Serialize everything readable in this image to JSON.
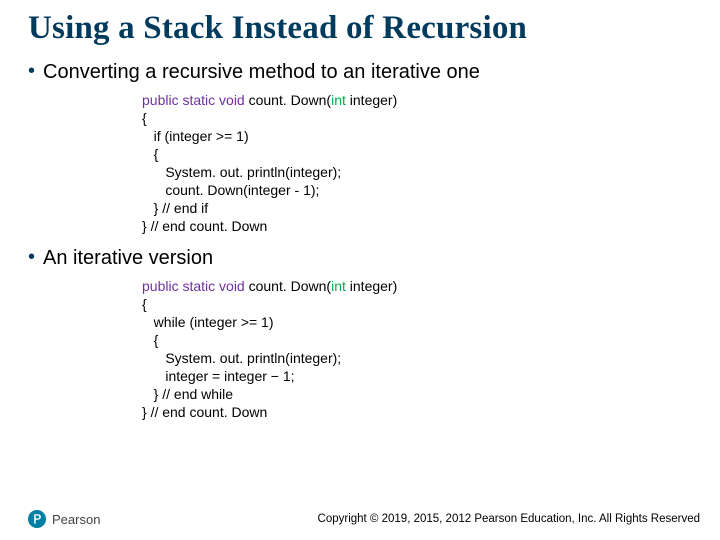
{
  "title": "Using a Stack Instead of Recursion",
  "bullet1": "Converting a recursive method to an iterative one",
  "bullet2": "An iterative version",
  "code1": {
    "sig_prefix": "public static void",
    "sig_name": " count. Down(",
    "sig_param_type": "int",
    "sig_param_name": " integer)",
    "l2": "{",
    "l3": "   if (integer >= 1)",
    "l4": "   {",
    "l5": "      System. out. println(integer);",
    "l6": "      count. Down(integer - 1);",
    "l7": "   } // end if",
    "l8": "} // end count. Down"
  },
  "code2": {
    "sig_prefix": "public static void",
    "sig_name": " count. Down(",
    "sig_param_type": "int",
    "sig_param_name": " integer)",
    "l2": "{",
    "l3": "   while (integer >= 1)",
    "l4": "   {",
    "l5": "      System. out. println(integer);",
    "l6": "      integer = integer − 1;",
    "l7": "   } // end while",
    "l8": "} // end count. Down"
  },
  "brand": "Pearson",
  "copyright": "Copyright © 2019, 2015, 2012 Pearson Education, Inc. All Rights Reserved"
}
